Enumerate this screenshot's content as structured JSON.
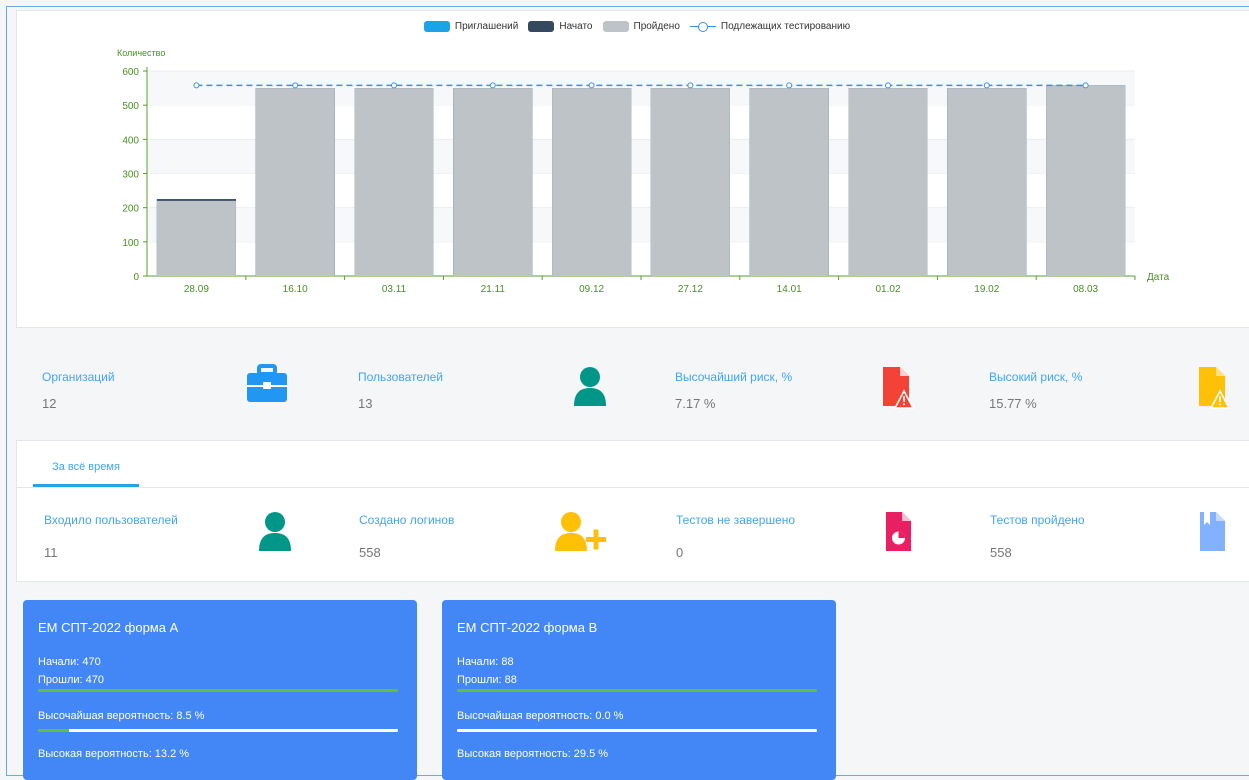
{
  "chart_data": {
    "type": "bar",
    "legend": [
      "Приглашений",
      "Начато",
      "Пройдено",
      "Подлежащих тестированию"
    ],
    "legend_colors": [
      "#1aa3e6",
      "#34495e",
      "#bdc3c7",
      "#3d8fe0"
    ],
    "legend_position": "top",
    "ylabel": "Количество",
    "xlabel": "Дата",
    "ylim": [
      0,
      600
    ],
    "yticks": [
      0,
      100,
      200,
      300,
      400,
      500,
      600
    ],
    "categories": [
      "28.09",
      "16.10",
      "03.11",
      "21.11",
      "09.12",
      "27.12",
      "14.01",
      "01.02",
      "19.02",
      "08.03"
    ],
    "series": [
      {
        "name": "Приглашений",
        "values": [
          225,
          550,
          550,
          550,
          550,
          550,
          550,
          550,
          550,
          558
        ]
      },
      {
        "name": "Начато",
        "values": [
          225,
          550,
          550,
          550,
          550,
          550,
          550,
          550,
          550,
          558
        ]
      },
      {
        "name": "Пройдено",
        "values": [
          220,
          550,
          550,
          550,
          550,
          550,
          550,
          550,
          550,
          558
        ]
      },
      {
        "name": "Подлежащих тестированию",
        "values": [
          558,
          558,
          558,
          558,
          558,
          558,
          558,
          558,
          558,
          558
        ]
      }
    ],
    "grid": true
  },
  "stats": [
    {
      "label": "Организаций",
      "value": "12",
      "icon": "briefcase-icon",
      "color": "#2196f3"
    },
    {
      "label": "Пользователей",
      "value": "13",
      "icon": "user-icon",
      "color": "#009688"
    },
    {
      "label": "Высочайший риск, %",
      "value": "7.17 %",
      "icon": "file-warning-icon",
      "color": "#f44336"
    },
    {
      "label": "Высокий риск, %",
      "value": "15.77 %",
      "icon": "file-warning-icon",
      "color": "#ffc107"
    }
  ],
  "all_time": {
    "tab_label": "За всё время",
    "stats": [
      {
        "label": "Входило пользователей",
        "value": "11",
        "icon": "user-icon",
        "color": "#009688"
      },
      {
        "label": "Создано логинов",
        "value": "558",
        "icon": "user-plus-icon",
        "color": "#ffc107"
      },
      {
        "label": "Тестов не завершено",
        "value": "0",
        "icon": "file-chart-icon",
        "color": "#e91e63"
      },
      {
        "label": "Тестов пройдено",
        "value": "558",
        "icon": "file-bookmark-icon",
        "color": "#82b1ff"
      }
    ]
  },
  "forms": [
    {
      "title": "ЕМ СПТ-2022 форма А",
      "started": "Начали: 470",
      "passed": "Прошли: 470",
      "highest": "Высочайшая вероятность: 8.5 %",
      "highest_pct": 8.5,
      "high": "Высокая вероятность: 13.2 %"
    },
    {
      "title": "ЕМ СПТ-2022 форма В",
      "started": "Начали: 88",
      "passed": "Прошли: 88",
      "highest": "Высочайшая вероятность: 0.0 %",
      "highest_pct": 0.0,
      "high": "Высокая вероятность: 29.5 %"
    }
  ]
}
